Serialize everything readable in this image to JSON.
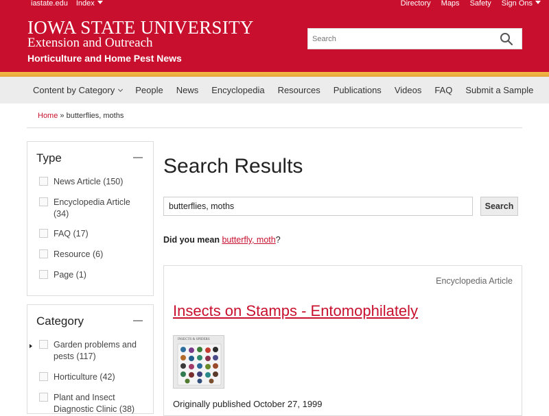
{
  "topbar": {
    "left_links": [
      "iastate.edu",
      "Index"
    ],
    "right_links": [
      "Directory",
      "Maps",
      "Safety",
      "Sign Ons"
    ]
  },
  "header": {
    "wordmark": "IOWA STATE UNIVERSITY",
    "subbrand": "Extension and Outreach",
    "site_name": "Horticulture and Home Pest News",
    "search_placeholder": "Search"
  },
  "nav": {
    "items": [
      "Content by Category",
      "People",
      "News",
      "Encyclopedia",
      "Resources",
      "Publications",
      "Videos",
      "FAQ",
      "Submit a Sample"
    ]
  },
  "breadcrumb": {
    "home": "Home",
    "separator": "»",
    "current": "butterflies, moths"
  },
  "facets": {
    "type": {
      "title": "Type",
      "options": [
        "News Article (150)",
        "Encyclopedia Article (34)",
        "FAQ (17)",
        "Resource (6)",
        "Page (1)"
      ]
    },
    "category": {
      "title": "Category",
      "options": [
        "Garden problems and pests (117)",
        "Horticulture (42)",
        "Plant and Insect Diagnostic Clinic (38)"
      ]
    }
  },
  "main": {
    "title": "Search Results",
    "query_value": "butterflies, moths",
    "search_button": "Search",
    "did_you_mean_label": "Did you mean",
    "suggestion": "butterfly, moth",
    "suggestion_suffix": "?"
  },
  "result": {
    "type": "Encyclopedia Article",
    "title": "Insects on Stamps - Entomophilately",
    "thumb_label": "INSECTS & SPIDERS",
    "published": "Originally published October 27, 1999"
  },
  "colors": {
    "brand_red": "#c8102e",
    "gold": "#f1be48",
    "nav_bg": "#ececec"
  }
}
